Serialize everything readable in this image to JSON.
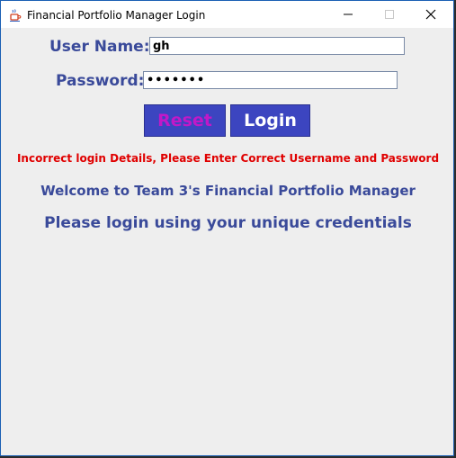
{
  "window": {
    "title": "Financial Portfolio Manager Login",
    "icon": "java-cup-icon"
  },
  "form": {
    "username_label": "User Name:",
    "username_value": "gh",
    "password_label": "Password:",
    "password_value": "•••••••",
    "reset_label": "Reset",
    "login_label": "Login"
  },
  "messages": {
    "error": "Incorrect login Details, Please Enter Correct Username and Password",
    "welcome": "Welcome to Team 3's Financial Portfolio Manager",
    "instruction": "Please login using your unique credentials"
  },
  "colors": {
    "label": "#3a4a9a",
    "button_bg": "#3c45c0",
    "reset_text": "#c218c8",
    "login_text": "#ffffff",
    "error": "#e00000"
  }
}
